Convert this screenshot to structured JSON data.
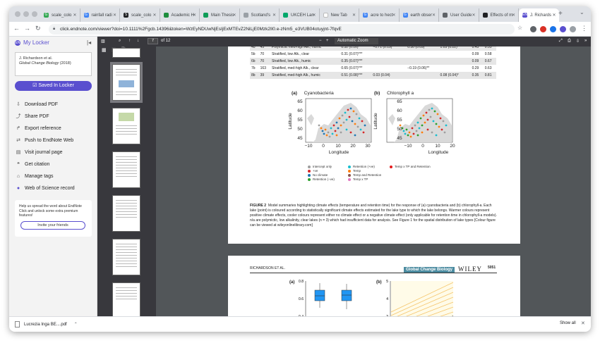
{
  "tabs": [
    {
      "title": "scale_colo",
      "color": "#34a853",
      "glyph": "G"
    },
    {
      "title": "rainfall radi",
      "color": "#4285f4",
      "glyph": "G"
    },
    {
      "title": "scale_colo",
      "color": "#202124",
      "glyph": "S"
    },
    {
      "title": "Academic H",
      "color": "#1e8e3e",
      "glyph": ""
    },
    {
      "title": "Main Thesis",
      "color": "#0f9d58",
      "glyph": ""
    },
    {
      "title": "Scotland's",
      "color": "#9aa0a6",
      "glyph": ""
    },
    {
      "title": "UKCEH Lan",
      "color": "#00a86b",
      "glyph": ""
    },
    {
      "title": "New Tab",
      "color": "#ffffff",
      "glyph": ""
    },
    {
      "title": "acre to hect",
      "color": "#4285f4",
      "glyph": "G"
    },
    {
      "title": "earth obser",
      "color": "#4285f4",
      "glyph": "G"
    },
    {
      "title": "User Guide",
      "color": "#5f6368",
      "glyph": ""
    },
    {
      "title": "Effects of m",
      "color": "#202124",
      "glyph": ""
    },
    {
      "title": "J. Richards",
      "color": "#5a4fcf",
      "glyph": "EN",
      "active": true
    }
  ],
  "url": "click.endnote.com/viewer?doi=10.1111%2Fgcb.14396&token=WzEyNDUwNjEsIjExMTEvZ2NiLjE0Mzk2Il0.e-zNm5_e3VUB04otuyjnt-7fqvE",
  "sidebar": {
    "title": "My Locker",
    "reference_authors": "J. Richardson et al.",
    "reference_journal": "Global Change Biology",
    "reference_year": "(2018)",
    "saved_label": "Saved In Locker",
    "menu": [
      {
        "icon": "download-icon",
        "glyph": "⇩",
        "label": "Download PDF"
      },
      {
        "icon": "share-icon",
        "glyph": "⤴",
        "label": "Share PDF"
      },
      {
        "icon": "export-icon",
        "glyph": "↱",
        "label": "Export reference"
      },
      {
        "icon": "push-icon",
        "glyph": "⇄",
        "label": "Push to EndNote Web"
      },
      {
        "icon": "journal-icon",
        "glyph": "▤",
        "label": "Visit journal page"
      },
      {
        "icon": "citation-icon",
        "glyph": "❝",
        "label": "Get citation"
      },
      {
        "icon": "tag-icon",
        "glyph": "⌂",
        "label": "Manage tags"
      },
      {
        "icon": "wos-icon",
        "glyph": "●",
        "label": "Web of Science record"
      }
    ],
    "promo_text": "Help us spread the word about EndNote Click and unlock some extra premium features!",
    "invite_label": "Invite your friends"
  },
  "pdf_toolbar": {
    "page_current": "7",
    "page_total": "of 12",
    "zoom": "Automatic Zoom"
  },
  "table_rows": [
    [
      "4b",
      "45",
      "Polymictic med-high Alk., humic",
      "0.32 (0.16)*",
      "−0.71 (0.19)***",
      "0.30 (0.09)**",
      "1.03 (0.22)***",
      "0.43",
      "0.55"
    ],
    [
      "5b",
      "70",
      "Stratified, low Alk., clear",
      "0.31 (0.07)***",
      "",
      "",
      "",
      "0.09",
      "0.58"
    ],
    [
      "6b",
      "70",
      "Stratified, low Alk., humic",
      "0.35 (0.07)***",
      "",
      "",
      "",
      "0.09",
      "0.67"
    ],
    [
      "7b",
      "163",
      "Stratified, med-high Alk., clear",
      "0.65 (0.07)***",
      "",
      "−0.19 (0.06)**",
      "",
      "0.29",
      "0.63"
    ],
    [
      "8b",
      "39",
      "Stratified, med-high Alk., humic",
      "0.51 (0.08)***",
      "0.03 (0.04)",
      "",
      "0.08 (0.04)*",
      "0.35",
      "0.81"
    ]
  ],
  "figure": {
    "panel_a_letter": "(a)",
    "panel_a_title": "Cyanobacteria",
    "panel_b_letter": "(b)",
    "panel_b_title": "Chlorophyll a",
    "y_label": "Latitude",
    "x_label": "Longitude",
    "y_ticks": [
      "65",
      "60",
      "55",
      "50",
      "45"
    ],
    "x_ticks": [
      "−10",
      "0",
      "10",
      "20",
      "30"
    ],
    "legend_col1": [
      "Intercept only",
      "+ve",
      "No climate",
      "Retention (−ve)"
    ],
    "legend_col2": [
      "Retention (+ve)",
      "Temp",
      "Temp and Retention",
      "Temp x TP"
    ],
    "legend_col3": [
      "Temp x TP and Retention"
    ],
    "legend_colors": [
      "#9e9e9e",
      "#d62728",
      "#1f77b4",
      "#2ca02c",
      "#17becf",
      "#ff7f0e",
      "#8c564b",
      "#e377c2",
      "#e41a1c"
    ],
    "caption_label": "FIGURE 2",
    "caption_text": "Model summaries highlighting climate effects (temperature and retention time) for the response of (a) cyanobacteria and (b) chlorophyll-a. Each lake (point) is coloured according to statistically significant climate effects estimated for the lake type to which the lake belongs. Warmer colours represent positive climate effects, cooler colours represent either no climate effect or a negative climate effect (only applicable for retention time in chlorophyll-a models). n/a are polymictic, low alkalinity, clear lakes (n = 3) which had insufficient data for analysis. See Figure 1 for the spatial distribution of lake types [Colour figure can be viewed at wileyonlinelibrary.com]"
  },
  "page2": {
    "running_head": "RICHARDSON ET AL.",
    "journal_banner": "Global Change Biology",
    "publisher": "WILEY",
    "page_number": "5051",
    "panel_a": "(a)",
    "panel_b": "(b)",
    "a_ticks": [
      "0.8",
      "0.6",
      "0.4"
    ],
    "b_ticks": [
      "5",
      "4",
      "3"
    ]
  },
  "download": {
    "filename": "Lucrezia Inga BE....pdf",
    "show_all": "Show all"
  }
}
